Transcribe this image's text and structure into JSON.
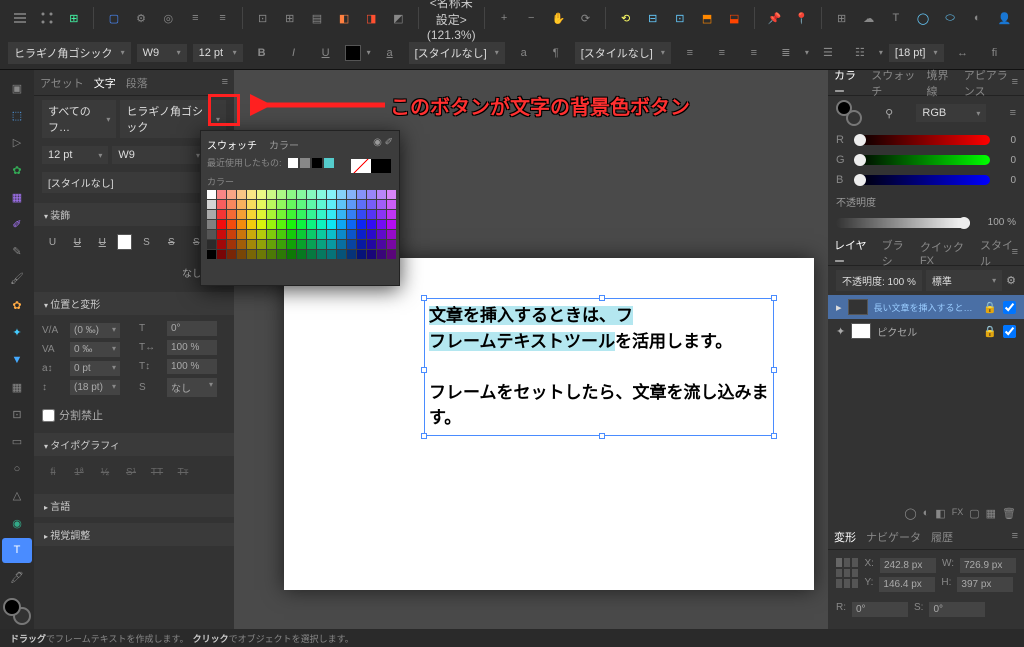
{
  "window": {
    "title": "<名称未設定> (121.3%)",
    "zoom": "121.3%"
  },
  "textbar": {
    "font": "ヒラギノ角ゴシック",
    "weight": "W9",
    "size": "12 pt",
    "para_style1": "[スタイルなし]",
    "para_style2": "[スタイルなし]",
    "leading": "[18 pt]"
  },
  "panel": {
    "tabs": [
      "アセット",
      "文字",
      "段落"
    ],
    "active_tab": "文字",
    "font_filter": "すべてのフ…",
    "font": "ヒラギノ角ゴシック",
    "size": "12 pt",
    "weight": "W9",
    "style_none": "[スタイルなし]",
    "sec_decor": "装飾",
    "decor_none": "なし",
    "sec_pos": "位置と変形",
    "tracking": "(0 ‰)",
    "kerning": "0 ‰",
    "baseline": "0 pt",
    "leading_sel": "(18 pt)",
    "rotation": "0°",
    "hscale": "100 %",
    "vscale": "100 %",
    "shear_none": "なし",
    "no_break": "分割禁止",
    "sec_typo": "タイポグラフィ",
    "sec_lang": "言語",
    "sec_optical": "視覚調整"
  },
  "colorpop": {
    "tab1": "スウォッチ",
    "tab2": "カラー",
    "recent_label": "最近使用したもの:",
    "color_label": "カラー"
  },
  "callout_text": "このボタンが文字の背景色ボタン",
  "canvas_text": {
    "l1a": "文章を挿入するときは、",
    "l1b": "フレームテキストツール",
    "l1c": "を活用します。",
    "l2": "フレームをセットしたら、文章を流し込みます。",
    "word_fu": "フ"
  },
  "right": {
    "tabs_color": [
      "カラー",
      "スウォッチ",
      "境界線",
      "アピアランス"
    ],
    "mode": "RGB",
    "r": "0",
    "g": "0",
    "b": "0",
    "opacity_label": "不透明度",
    "opacity": "100 %",
    "tabs_layer": [
      "レイヤー",
      "ブラシ",
      "クイックFX",
      "スタイル"
    ],
    "layer_opacity": "不透明度: 100 %",
    "blend": "標準",
    "layer1": "長い文章を挿入するときは、フレー…",
    "layer2": "ピクセル",
    "tabs_transform": [
      "変形",
      "ナビゲータ",
      "履歴"
    ],
    "x": "242.8 px",
    "y": "146.4 px",
    "w": "726.9 px",
    "h": "397 px",
    "rot": "0°",
    "shear": "0°",
    "r_label": "R:",
    "s_label": "S:",
    "x_label": "X:",
    "y_label": "Y:",
    "w_label": "W:",
    "h_label": "H:"
  },
  "status": {
    "drag": "ドラッグ",
    "mid1": "でフレームテキストを作成します。",
    "click": "クリック",
    "mid2": "でオブジェクトを選択します。"
  }
}
